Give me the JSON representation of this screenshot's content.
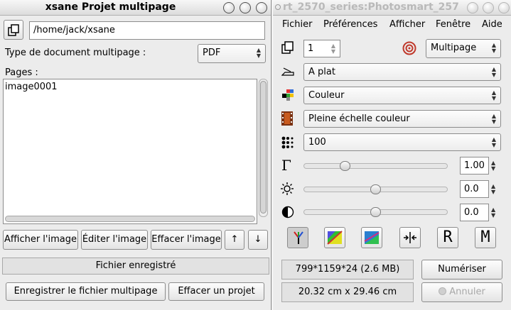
{
  "multipage": {
    "title": "xsane Projet multipage",
    "path": "/home/jack/xsane",
    "doc_type_label": "Type de document multipage :",
    "doc_type_value": "PDF",
    "pages_label": "Pages :",
    "pages": [
      "image0001"
    ],
    "buttons": {
      "show": "Afficher l'image",
      "edit": "Éditer l'image",
      "delete": "Effacer l'image",
      "up": "↑",
      "down": "↓"
    },
    "status": "Fichier enregistré",
    "save_button": "Enregistrer le fichier multipage",
    "delete_project_button": "Effacer un projet"
  },
  "scanner": {
    "title": "rt_2570_series:Photosmart_257",
    "menu": [
      "Fichier",
      "Préférences",
      "Afficher",
      "Fenêtre",
      "Aide"
    ],
    "copies": "1",
    "target": "Multipage",
    "source": "A plat",
    "mode": "Couleur",
    "range": "Pleine échelle couleur",
    "resolution": "100",
    "gamma": {
      "value": "1.00",
      "slider_fraction": 0.27
    },
    "brightness": {
      "value": "0.0",
      "slider_fraction": 0.5
    },
    "contrast": {
      "value": "0.0",
      "slider_fraction": 0.5
    },
    "tools": [
      "histogram-icon",
      "standard-enhancement-icon",
      "auto-enhancement-icon",
      "restore-enhancement-icon",
      "R",
      "M"
    ],
    "image_size": "799*1159*24 (2.6 MB)",
    "scan_button": "Numériser",
    "dimensions": "20.32 cm x 29.46 cm",
    "cancel_button": "Annuler"
  }
}
